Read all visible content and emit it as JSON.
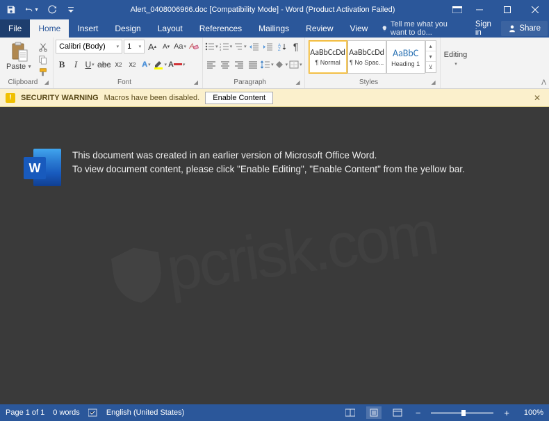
{
  "titlebar": {
    "title": "Alert_0408006966.doc [Compatibility Mode] - Word (Product Activation Failed)"
  },
  "menubar": {
    "file": "File",
    "home": "Home",
    "insert": "Insert",
    "design": "Design",
    "layout": "Layout",
    "references": "References",
    "mailings": "Mailings",
    "review": "Review",
    "view": "View",
    "tell_me": "Tell me what you want to do...",
    "sign_in": "Sign in",
    "share": "Share"
  },
  "ribbon": {
    "clipboard": {
      "paste": "Paste",
      "label": "Clipboard"
    },
    "font": {
      "name": "Calibri (Body)",
      "size": "1",
      "label": "Font"
    },
    "paragraph": {
      "label": "Paragraph"
    },
    "styles": {
      "label": "Styles",
      "items": [
        {
          "sample": "AaBbCcDd",
          "name": "¶ Normal"
        },
        {
          "sample": "AaBbCcDd",
          "name": "¶ No Spac..."
        },
        {
          "sample": "AaBbC",
          "name": "Heading 1"
        }
      ]
    },
    "editing": {
      "label": "Editing"
    }
  },
  "security": {
    "title": "SECURITY WARNING",
    "message": "Macros have been disabled.",
    "button": "Enable Content"
  },
  "document": {
    "line1": "This document was created in an earlier version of Microsoft Office Word.",
    "line2": "To view document content, please click \"Enable Editing\", \"Enable Content\" from the yellow bar."
  },
  "watermark": "pcrisk.com",
  "statusbar": {
    "page": "Page 1 of 1",
    "words": "0 words",
    "language": "English (United States)",
    "zoom": "100%"
  }
}
